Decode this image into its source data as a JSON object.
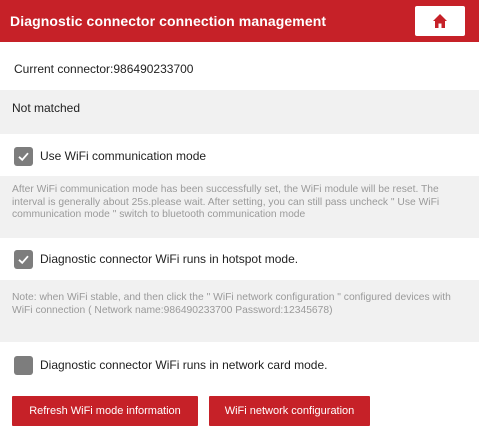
{
  "header": {
    "title": "Diagnostic connector connection management",
    "home_icon": "home-icon",
    "accent_color": "#c62128"
  },
  "connector": {
    "text": "Current connector:986490233700"
  },
  "status": {
    "text": "Not matched"
  },
  "options": {
    "wifi_mode": {
      "label": "Use WiFi communication mode",
      "checked": true
    },
    "wifi_mode_note": "After WiFi communication mode has been successfully set, the WiFi module will be reset. The interval is generally about 25s.please wait. After setting, you can still pass uncheck \" Use WiFi communication mode \" switch to bluetooth communication mode",
    "hotspot": {
      "label": "Diagnostic connector WiFi runs in hotspot mode.",
      "checked": true
    },
    "hotspot_note": "Note: when WiFi stable, and then click the \" WiFi network configuration \" configured devices with WiFi connection ( Network name:986490233700 Password:12345678)",
    "network_card": {
      "label": "Diagnostic connector WiFi runs in network card mode.",
      "checked": false
    }
  },
  "footer": {
    "refresh_label": "Refresh WiFi mode information",
    "config_label": "WiFi network configuration"
  }
}
